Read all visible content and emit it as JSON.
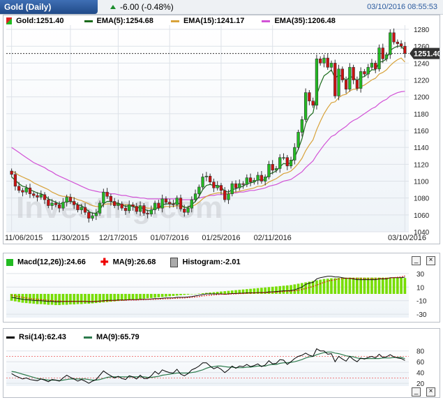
{
  "header": {
    "title": "Gold (Daily)",
    "change": "-6.00 (-0.48%)",
    "timestamp": "03/10/2016 08:55:53"
  },
  "colors": {
    "up": "#22bb22",
    "down": "#cc1111",
    "ema5": "#1a6b1a",
    "ema15": "#d8a23a",
    "ema35": "#d253d6",
    "macd": "#77dd00",
    "macd_signal": "#dd0000",
    "rsi": "#000000",
    "rsi_ma": "#2c7a4c"
  },
  "price_panel": {
    "legend": [
      {
        "label": "Gold:1251.40",
        "icon": "candle-legend-icon"
      },
      {
        "label": "EMA(5):1254.68",
        "icon": "ema5-line-icon"
      },
      {
        "label": "EMA(15):1241.17",
        "icon": "ema15-line-icon"
      },
      {
        "label": "EMA(35):1206.48",
        "icon": "ema35-line-icon"
      }
    ],
    "last_price_label": "1251.40",
    "watermark": "Investing.com"
  },
  "macd_panel": {
    "legend": [
      {
        "label": "Macd(12,26)):24.66"
      },
      {
        "label": "MA(9):26.68"
      },
      {
        "label": "Histogram:-2.01"
      }
    ],
    "minimize": "_",
    "close": "×"
  },
  "rsi_panel": {
    "legend": [
      {
        "label": "Rsi(14):62.43"
      },
      {
        "label": "MA(9):65.79"
      }
    ],
    "minimize": "_",
    "close": "×"
  },
  "chart_data": [
    {
      "type": "candlestick",
      "title": "Gold (Daily)",
      "x_tick_labels": [
        "11/06/2015",
        "11/30/2015",
        "12/17/2015",
        "01/07/2016",
        "01/25/2016",
        "02/11/2016",
        "03/10/2016"
      ],
      "y_tick_labels": [
        1040,
        1060,
        1080,
        1100,
        1120,
        1140,
        1160,
        1180,
        1200,
        1220,
        1240,
        1260,
        1280
      ],
      "ylim": [
        1040,
        1285
      ],
      "last_price": 1251.4,
      "closes": [
        1108,
        1094,
        1089,
        1087,
        1092,
        1085,
        1083,
        1081,
        1084,
        1078,
        1071,
        1074,
        1072,
        1068,
        1075,
        1081,
        1076,
        1072,
        1066,
        1069,
        1063,
        1056,
        1059,
        1062,
        1074,
        1087,
        1082,
        1076,
        1071,
        1073,
        1068,
        1065,
        1072,
        1070,
        1064,
        1071,
        1062,
        1061,
        1066,
        1074,
        1068,
        1079,
        1075,
        1073,
        1072,
        1080,
        1067,
        1063,
        1068,
        1078,
        1085,
        1093,
        1105,
        1106,
        1099,
        1092,
        1095,
        1089,
        1078,
        1085,
        1097,
        1092,
        1097,
        1096,
        1104,
        1099,
        1101,
        1107,
        1100,
        1105,
        1120,
        1113,
        1115,
        1128,
        1128,
        1118,
        1125,
        1140,
        1158,
        1173,
        1205,
        1195,
        1190,
        1245,
        1240,
        1246,
        1235,
        1240,
        1201,
        1233,
        1220,
        1209,
        1235,
        1220,
        1210,
        1230,
        1227,
        1235,
        1240,
        1233,
        1258,
        1245,
        1250,
        1276,
        1265,
        1263,
        1260,
        1251.4
      ],
      "ema5": [
        1105,
        1101,
        1097,
        1094,
        1093,
        1090,
        1088,
        1086,
        1085,
        1083,
        1079,
        1077,
        1075,
        1073,
        1074,
        1076,
        1076,
        1075,
        1072,
        1071,
        1068,
        1064,
        1062,
        1062,
        1066,
        1073,
        1076,
        1076,
        1074,
        1074,
        1072,
        1070,
        1071,
        1070,
        1068,
        1069,
        1067,
        1065,
        1065,
        1068,
        1068,
        1072,
        1073,
        1073,
        1073,
        1075,
        1072,
        1069,
        1069,
        1072,
        1076,
        1082,
        1090,
        1095,
        1096,
        1095,
        1095,
        1093,
        1088,
        1087,
        1090,
        1091,
        1093,
        1094,
        1097,
        1098,
        1099,
        1102,
        1101,
        1102,
        1108,
        1110,
        1112,
        1117,
        1121,
        1120,
        1122,
        1128,
        1138,
        1150,
        1168,
        1177,
        1181,
        1202,
        1215,
        1225,
        1228,
        1232,
        1222,
        1226,
        1224,
        1219,
        1224,
        1223,
        1219,
        1223,
        1224,
        1228,
        1232,
        1232,
        1241,
        1242,
        1245,
        1255,
        1258,
        1260,
        1260,
        1254.7
      ],
      "ema15": [
        1112,
        1110,
        1107,
        1105,
        1103,
        1101,
        1098,
        1096,
        1094,
        1092,
        1090,
        1087,
        1085,
        1083,
        1082,
        1082,
        1081,
        1080,
        1078,
        1077,
        1075,
        1073,
        1071,
        1070,
        1070,
        1072,
        1073,
        1073,
        1073,
        1073,
        1072,
        1072,
        1072,
        1071,
        1070,
        1070,
        1069,
        1068,
        1068,
        1068,
        1068,
        1069,
        1070,
        1070,
        1070,
        1071,
        1070,
        1069,
        1069,
        1070,
        1072,
        1075,
        1079,
        1082,
        1084,
        1085,
        1086,
        1086,
        1085,
        1085,
        1087,
        1087,
        1088,
        1089,
        1090,
        1091,
        1092,
        1094,
        1094,
        1096,
        1099,
        1101,
        1103,
        1106,
        1109,
        1110,
        1112,
        1116,
        1121,
        1127,
        1136,
        1143,
        1149,
        1161,
        1171,
        1180,
        1187,
        1193,
        1194,
        1199,
        1202,
        1203,
        1207,
        1209,
        1209,
        1212,
        1214,
        1217,
        1220,
        1222,
        1227,
        1229,
        1232,
        1237,
        1241,
        1244,
        1246,
        1241.2
      ],
      "ema35": [
        1140,
        1137,
        1134,
        1131,
        1128,
        1125,
        1122,
        1120,
        1118,
        1116,
        1113,
        1111,
        1108,
        1106,
        1104,
        1102,
        1100,
        1098,
        1096,
        1094,
        1092,
        1090,
        1089,
        1088,
        1087,
        1087,
        1086,
        1085,
        1085,
        1084,
        1083,
        1083,
        1082,
        1081,
        1081,
        1080,
        1080,
        1079,
        1079,
        1079,
        1079,
        1079,
        1079,
        1079,
        1079,
        1079,
        1078,
        1078,
        1078,
        1078,
        1079,
        1080,
        1081,
        1082,
        1083,
        1083,
        1084,
        1084,
        1084,
        1085,
        1086,
        1086,
        1087,
        1087,
        1088,
        1089,
        1089,
        1090,
        1091,
        1092,
        1094,
        1095,
        1096,
        1098,
        1100,
        1101,
        1102,
        1105,
        1108,
        1111,
        1116,
        1120,
        1124,
        1131,
        1137,
        1143,
        1148,
        1153,
        1155,
        1159,
        1162,
        1165,
        1169,
        1172,
        1174,
        1177,
        1180,
        1183,
        1186,
        1188,
        1192,
        1195,
        1197,
        1201,
        1203,
        1205,
        1206,
        1206.5
      ]
    },
    {
      "type": "bar",
      "title": "Macd(12,26))",
      "y_tick_labels": [
        30,
        10,
        -10,
        -30
      ],
      "ylim": [
        -35,
        35
      ],
      "macd_last": 24.66,
      "signal_last": 26.68,
      "histogram_last": -2.01,
      "macd": [
        -5,
        -6,
        -7,
        -8,
        -8.5,
        -9,
        -9.5,
        -10,
        -10,
        -10.5,
        -11,
        -11,
        -11.5,
        -11.5,
        -11,
        -11,
        -11,
        -11,
        -11,
        -11,
        -11,
        -11.5,
        -11.5,
        -11,
        -10.5,
        -10,
        -9.5,
        -9.5,
        -9.5,
        -9,
        -9,
        -9,
        -8.5,
        -8.5,
        -8.5,
        -8,
        -8,
        -8,
        -7.5,
        -7,
        -7,
        -6.5,
        -6,
        -6,
        -6,
        -5,
        -5,
        -5,
        -4.5,
        -4,
        -3,
        -2,
        -1,
        0,
        0,
        0,
        0,
        0,
        -0.5,
        0,
        0.5,
        0.5,
        1,
        1,
        1.5,
        1.5,
        1.5,
        2,
        2,
        2,
        3,
        3,
        3.5,
        4,
        4.5,
        4.5,
        5,
        6,
        8,
        10,
        14,
        16,
        17,
        22,
        24,
        25,
        26,
        26,
        25,
        25,
        24,
        23,
        23,
        22,
        21,
        21,
        21,
        21,
        21,
        21,
        22,
        22,
        22,
        24,
        24,
        24,
        24,
        24.66
      ],
      "signal": [
        -2,
        -3,
        -4,
        -5,
        -6,
        -7,
        -7.5,
        -8,
        -8.5,
        -9,
        -9.5,
        -10,
        -10.5,
        -10.5,
        -11,
        -11,
        -11,
        -11,
        -11,
        -11,
        -11,
        -11,
        -11,
        -11,
        -11,
        -10.5,
        -10.5,
        -10,
        -10,
        -9.5,
        -9.5,
        -9.5,
        -9,
        -9,
        -9,
        -8.5,
        -8.5,
        -8,
        -8,
        -8,
        -7.5,
        -7.5,
        -7,
        -7,
        -6.5,
        -6.5,
        -6,
        -6,
        -5.5,
        -5,
        -4.5,
        -4,
        -3,
        -2.5,
        -2,
        -1.5,
        -1,
        -0.5,
        -0.5,
        -0.5,
        0,
        0,
        0.5,
        0.5,
        1,
        1,
        1.5,
        1.5,
        1.5,
        2,
        2,
        2.5,
        2.5,
        3,
        3.5,
        4,
        4,
        4.5,
        5.5,
        6.5,
        8,
        9.5,
        11,
        13,
        15,
        17,
        19,
        20,
        21,
        22,
        22.5,
        23,
        23,
        23,
        23,
        23,
        22.5,
        22.5,
        22.5,
        22.5,
        22.5,
        23,
        23,
        23.5,
        24,
        24.5,
        25,
        26.68
      ],
      "histogram": [
        -10,
        -11,
        -12,
        -13,
        -13.5,
        -14,
        -14.5,
        -15,
        -15,
        -15.5,
        -16,
        -16,
        -16.5,
        -16.5,
        -16,
        -16,
        -15.5,
        -15.5,
        -15,
        -15,
        -14.5,
        -14.5,
        -14,
        -13.5,
        -13,
        -12.5,
        -12,
        -11.5,
        -11,
        -10.5,
        -10,
        -9.5,
        -9,
        -8.5,
        -8,
        -7.5,
        -7,
        -6.5,
        -6,
        -5.5,
        -5,
        -4.5,
        -4,
        -3.5,
        -3,
        -2.5,
        -2,
        -1.5,
        -1,
        -0.5,
        0,
        0.5,
        1,
        1.5,
        2,
        2.5,
        3,
        3.5,
        4,
        4.5,
        5,
        5.5,
        6,
        6.5,
        7,
        7.5,
        8,
        8.5,
        9,
        9.5,
        10,
        10.5,
        11,
        11.5,
        12,
        12.5,
        13,
        14,
        15,
        16,
        17,
        18,
        19,
        20,
        21,
        22,
        22.5,
        23,
        23,
        23.5,
        23.5,
        24,
        24,
        24,
        24,
        24,
        24,
        24,
        24,
        24,
        24,
        24,
        24,
        24,
        24,
        24,
        24,
        23.5
      ]
    },
    {
      "type": "line",
      "title": "Rsi(14)",
      "y_tick_labels": [
        80,
        60,
        40,
        20
      ],
      "ylim": [
        15,
        90
      ],
      "rsi_last": 62.43,
      "ma_last": 65.79,
      "rsi": [
        38,
        34,
        31,
        28,
        30,
        27,
        26,
        25,
        28,
        26,
        23,
        27,
        26,
        24,
        30,
        35,
        31,
        28,
        24,
        27,
        24,
        20,
        24,
        27,
        35,
        43,
        38,
        34,
        30,
        33,
        29,
        27,
        34,
        32,
        28,
        35,
        29,
        29,
        34,
        42,
        37,
        45,
        42,
        40,
        39,
        46,
        37,
        34,
        38,
        45,
        48,
        52,
        58,
        58,
        52,
        47,
        50,
        46,
        40,
        45,
        52,
        48,
        52,
        51,
        55,
        51,
        53,
        56,
        51,
        54,
        62,
        56,
        57,
        64,
        63,
        55,
        60,
        66,
        70,
        72,
        76,
        72,
        70,
        84,
        80,
        80,
        74,
        75,
        60,
        70,
        65,
        61,
        70,
        64,
        60,
        67,
        65,
        68,
        70,
        67,
        74,
        68,
        69,
        73,
        69,
        67,
        66,
        62.43
      ],
      "ma": [
        42,
        41,
        39,
        37,
        35,
        33,
        31,
        29,
        28,
        27,
        26,
        26,
        26,
        25,
        26,
        27,
        28,
        28,
        28,
        28,
        28,
        27,
        26,
        26,
        27,
        29,
        31,
        32,
        32,
        32,
        32,
        32,
        32,
        32,
        32,
        32,
        32,
        31,
        31,
        32,
        33,
        35,
        36,
        37,
        38,
        39,
        39,
        39,
        39,
        40,
        41,
        43,
        45,
        48,
        50,
        51,
        52,
        52,
        51,
        50,
        50,
        49,
        49,
        49,
        50,
        50,
        51,
        52,
        52,
        52,
        54,
        55,
        55,
        57,
        58,
        58,
        59,
        60,
        62,
        64,
        67,
        69,
        70,
        73,
        75,
        77,
        78,
        78,
        76,
        75,
        73,
        71,
        70,
        69,
        67,
        66,
        66,
        66,
        66,
        66,
        66,
        67,
        67,
        67,
        68,
        68,
        68,
        65.79
      ]
    }
  ]
}
